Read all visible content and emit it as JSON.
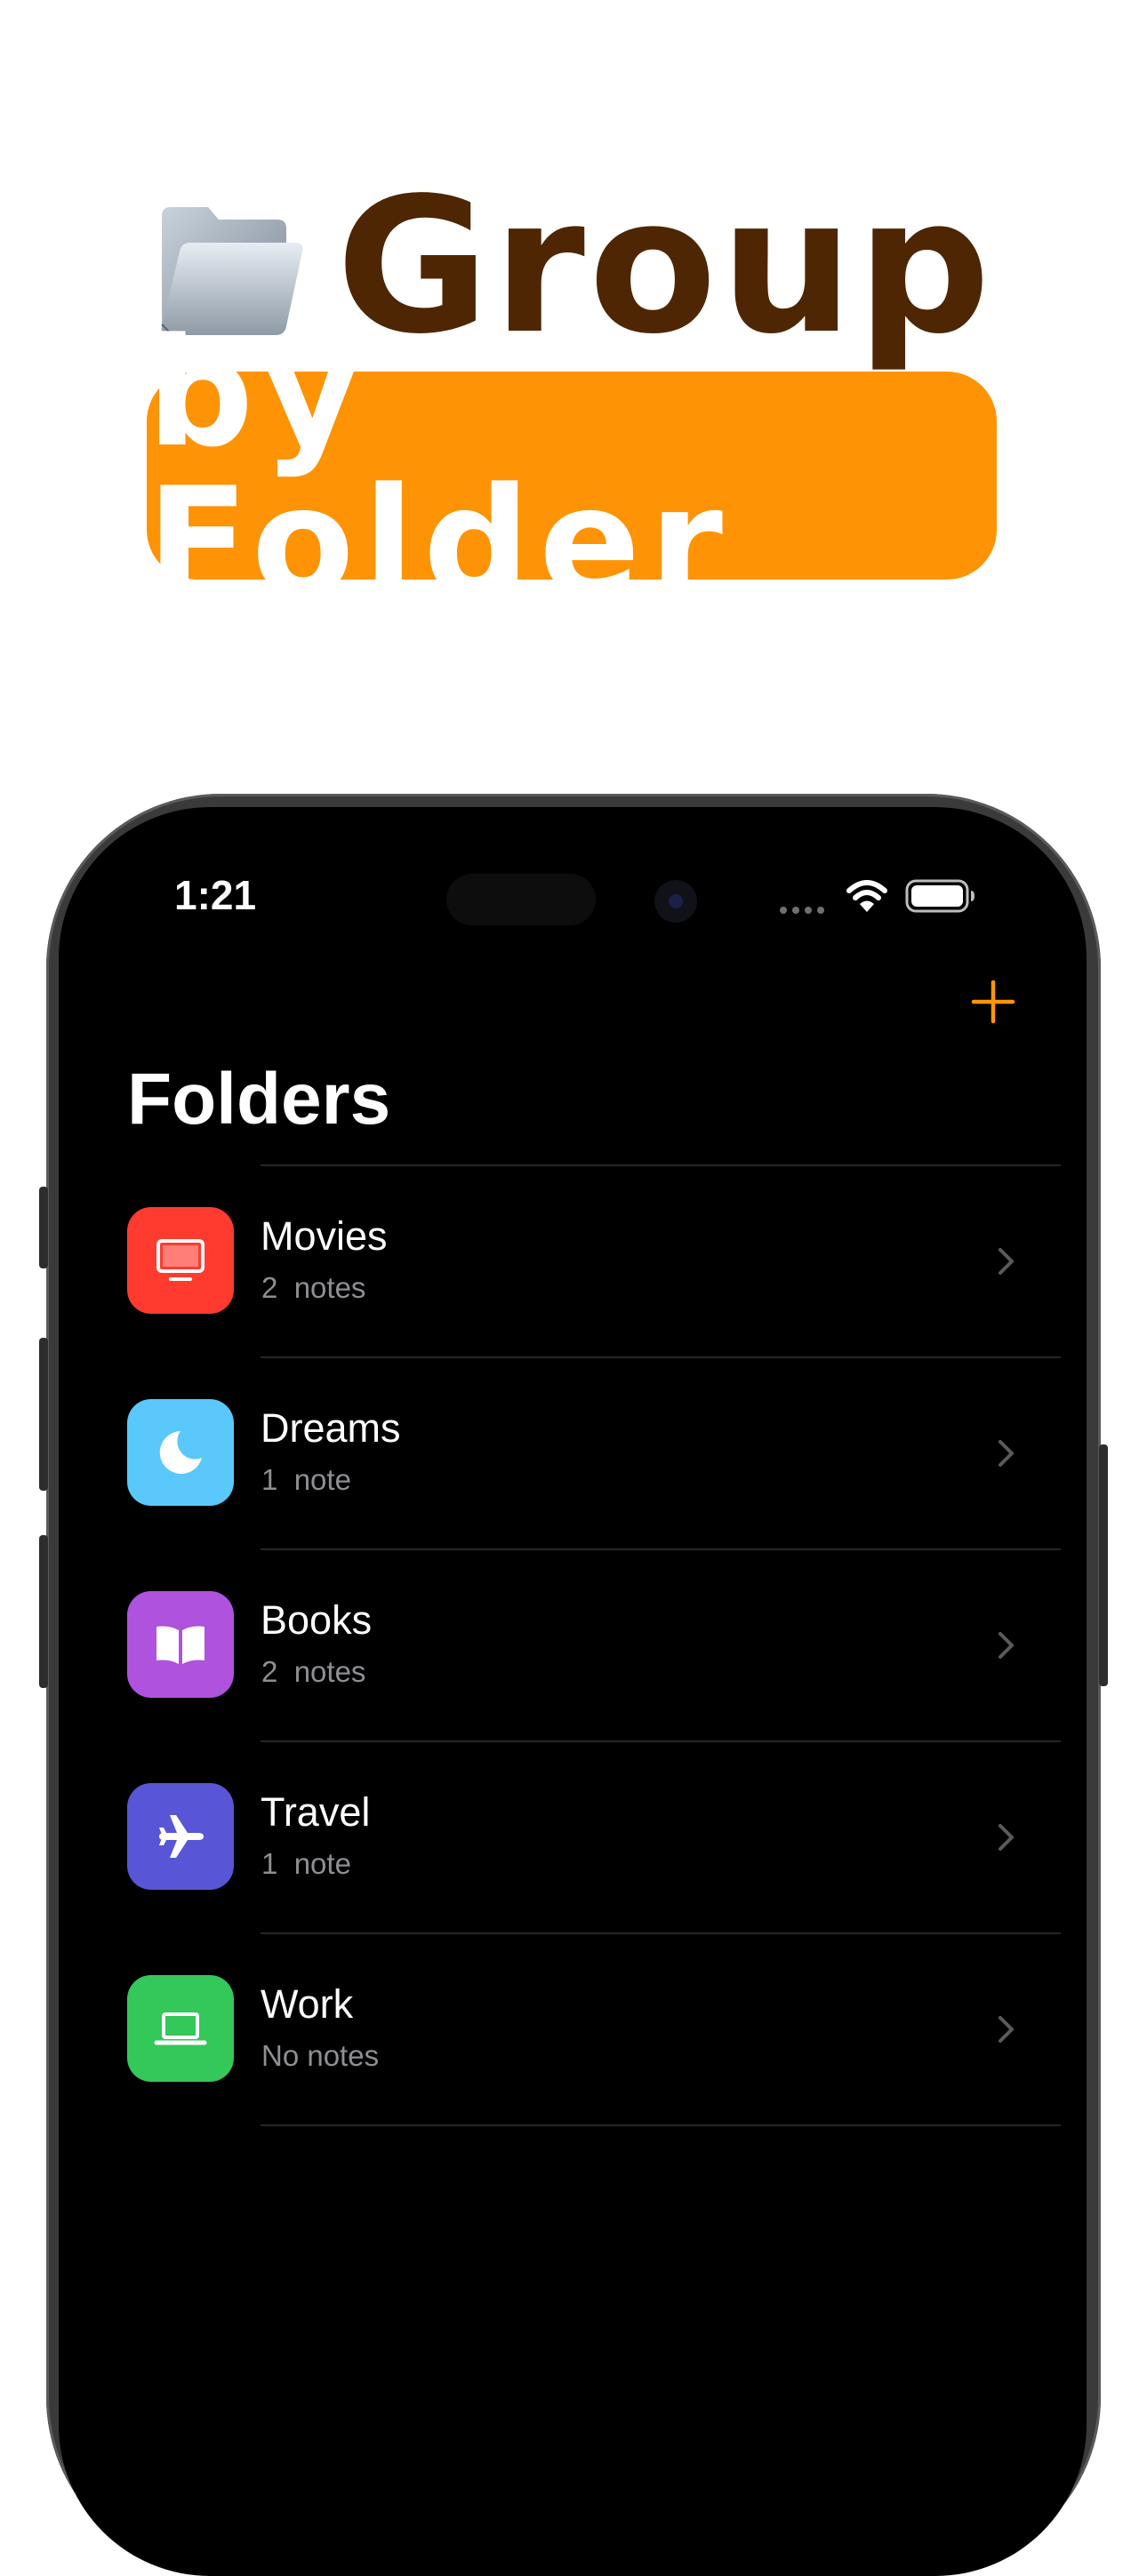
{
  "promo": {
    "headline": "Group",
    "subheadline": "by Folder",
    "icon": "folder-icon",
    "colors": {
      "headline": "#4f2603",
      "pill_background": "#fe9405",
      "pill_text": "#ffffff"
    }
  },
  "status_bar": {
    "time": "1:21",
    "icons": [
      "cellular-dots-icon",
      "wifi-icon",
      "battery-icon"
    ]
  },
  "nav": {
    "add_icon": "plus-icon",
    "accent_color": "#ff9500"
  },
  "page": {
    "title": "Folders"
  },
  "folders": [
    {
      "name": "Movies",
      "count": "2  notes",
      "icon": "tv-icon",
      "color": "#ff3b30"
    },
    {
      "name": "Dreams",
      "count": "1  note",
      "icon": "moon-icon",
      "color": "#5ac8fa"
    },
    {
      "name": "Books",
      "count": "2  notes",
      "icon": "book-icon",
      "color": "#af52de"
    },
    {
      "name": "Travel",
      "count": "1  note",
      "icon": "airplane-icon",
      "color": "#5856d6"
    },
    {
      "name": "Work",
      "count": "No notes",
      "icon": "laptop-icon",
      "color": "#34c759"
    }
  ]
}
